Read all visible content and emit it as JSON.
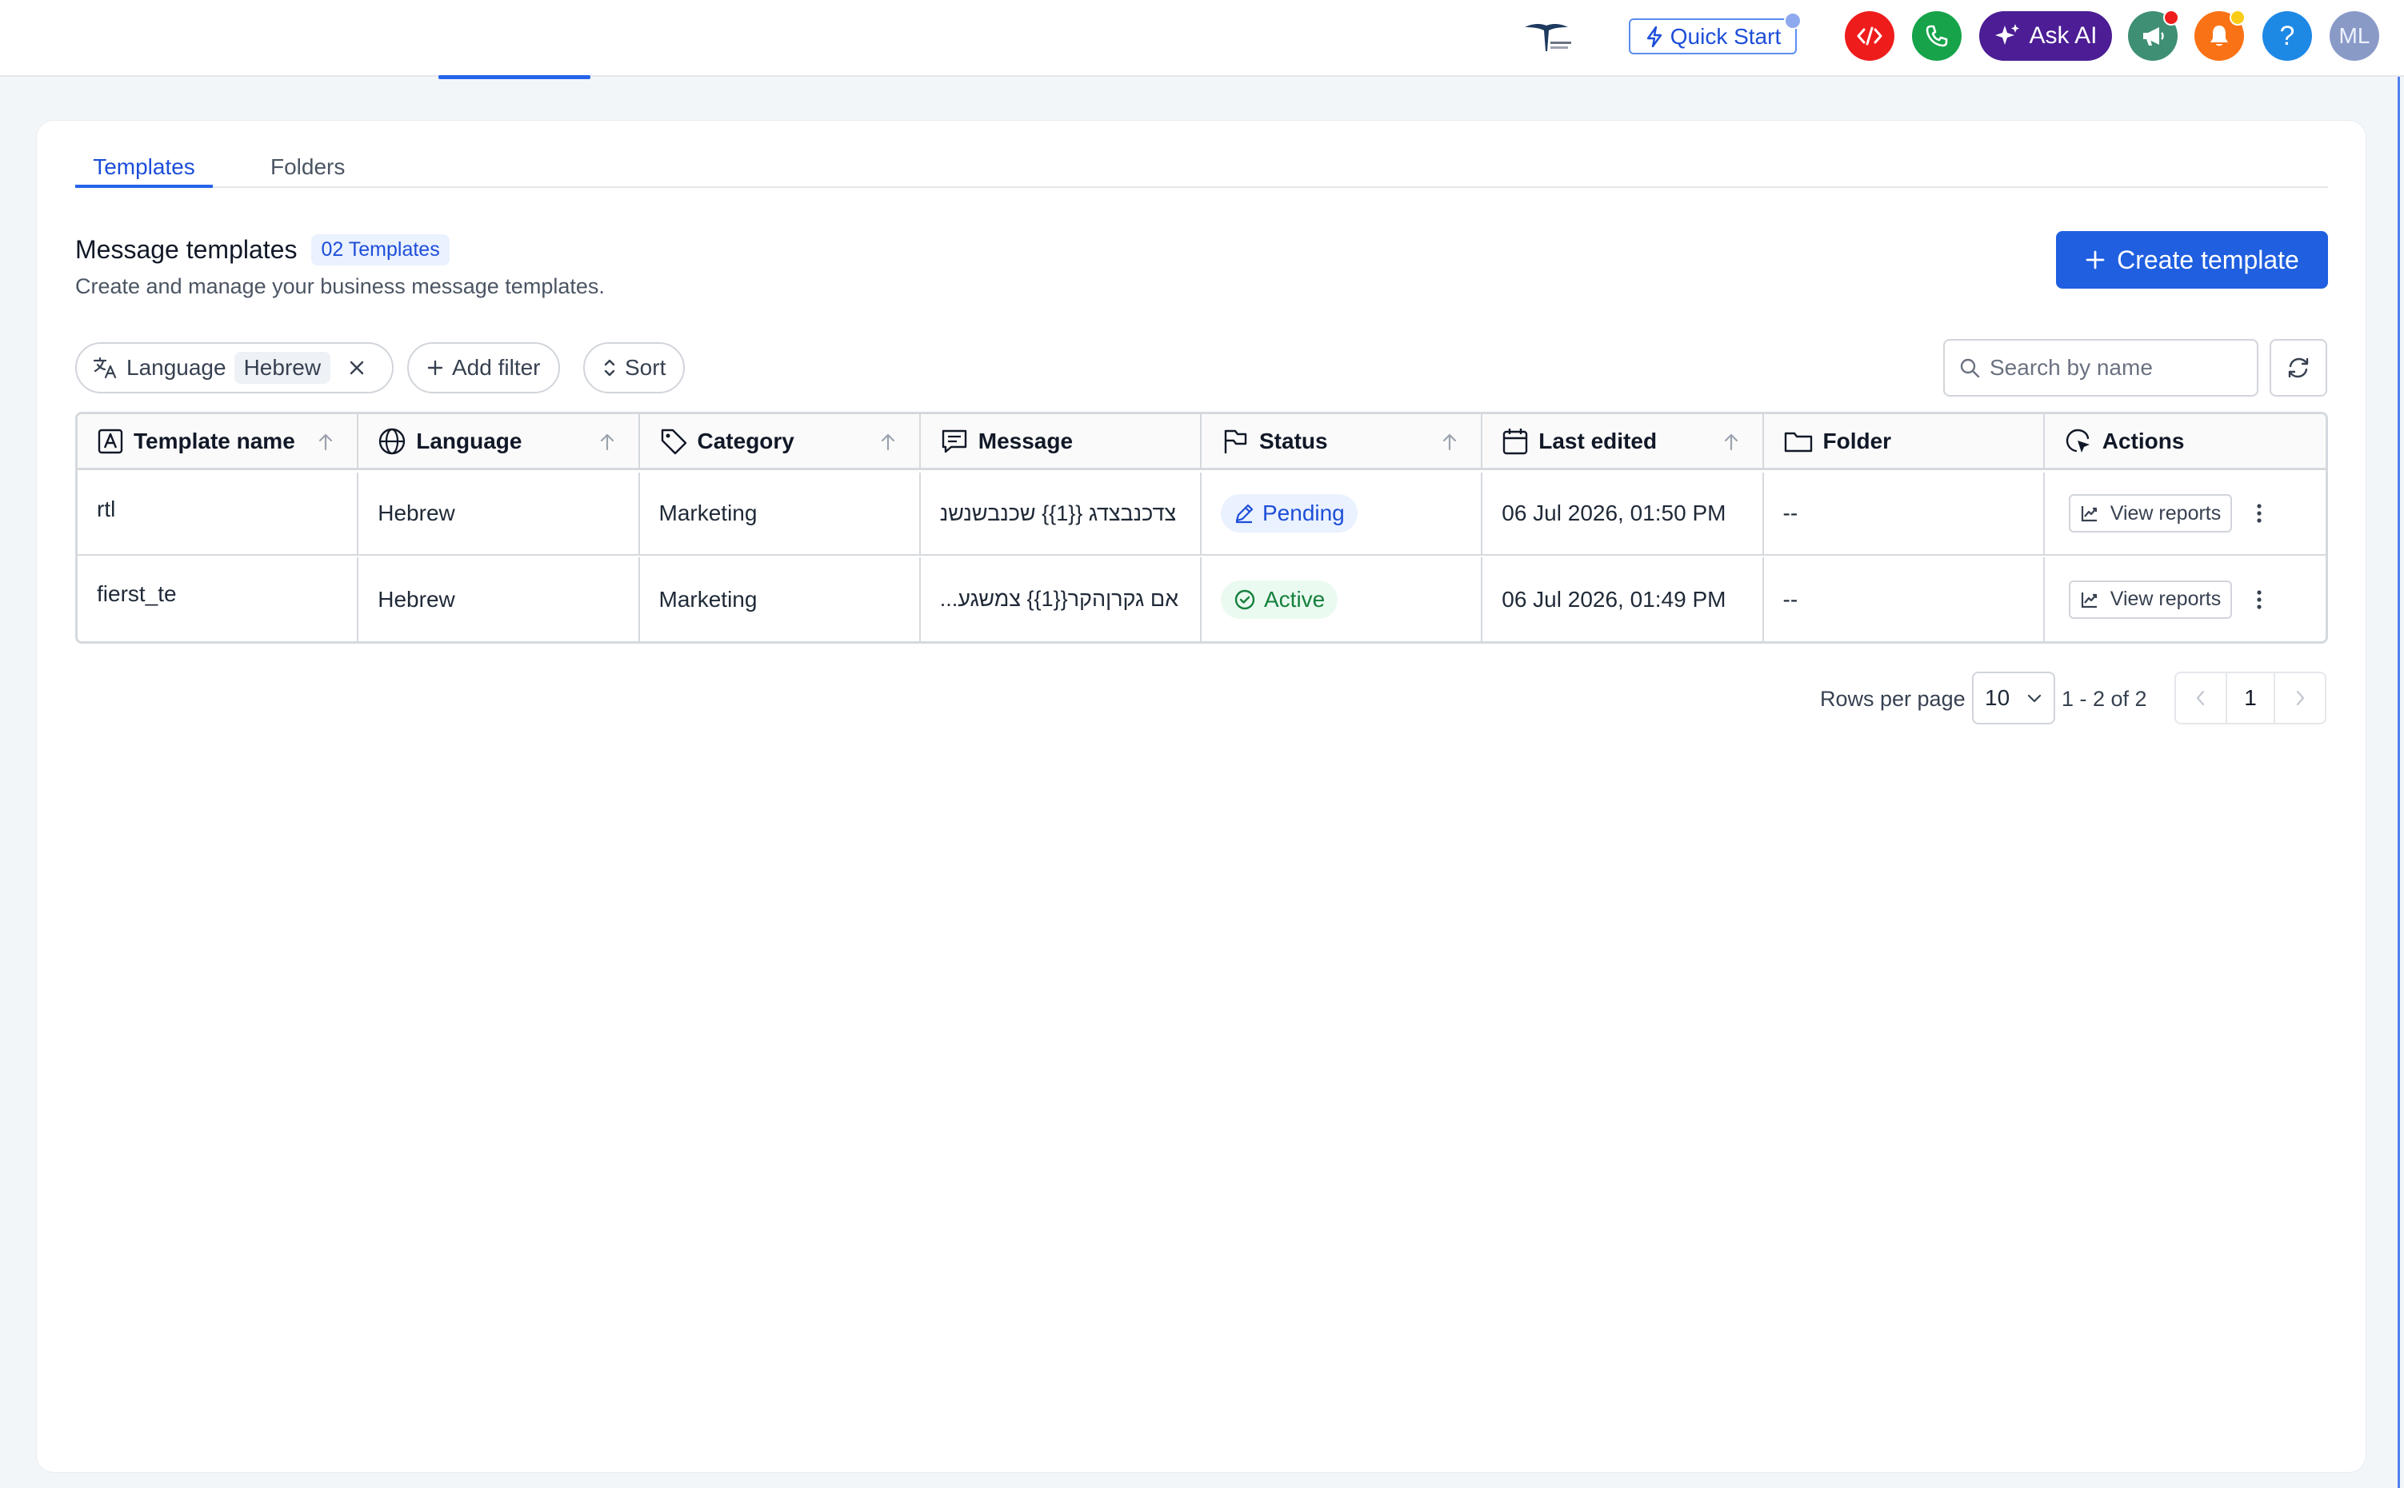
{
  "topbar": {
    "quick_start_label": "Quick Start",
    "ask_ai_label": "Ask AI",
    "help_label": "?",
    "avatar_initials": "ML",
    "colors": {
      "code": "#ef1c1c",
      "phone": "#16a34a",
      "ask_ai": "#4c1d95",
      "megaphone": "#3f8f74",
      "bell": "#f97316",
      "help": "#1e88e5"
    }
  },
  "tabs": [
    {
      "label": "Templates",
      "active": true
    },
    {
      "label": "Folders",
      "active": false
    }
  ],
  "header": {
    "title": "Message templates",
    "count_badge": "02 Templates",
    "subtitle": "Create and manage your business message templates.",
    "create_button": "Create template"
  },
  "filters": {
    "language_label": "Language",
    "language_value": "Hebrew",
    "add_filter_label": "Add filter",
    "sort_label": "Sort",
    "search_placeholder": "Search by name"
  },
  "table": {
    "columns": [
      "Template name",
      "Language",
      "Category",
      "Message",
      "Status",
      "Last edited",
      "Folder",
      "Actions"
    ],
    "rows": [
      {
        "name": "rtl",
        "language": "Hebrew",
        "category": "Marketing",
        "message": "צדכנבצדג {{1}} שכנבשנשנ",
        "status": "Pending",
        "last_edited": "06 Jul 2026, 01:50 PM",
        "folder": "--",
        "action": "View reports"
      },
      {
        "name": "fierst_te",
        "language": "Hebrew",
        "category": "Marketing",
        "message": "...אם גקרןהקר{{1}} צמשגע",
        "status": "Active",
        "last_edited": "06 Jul 2026, 01:49 PM",
        "folder": "--",
        "action": "View reports"
      }
    ]
  },
  "pagination": {
    "rows_per_page_label": "Rows per page",
    "rows_per_page_value": "10",
    "range": "1 - 2 of 2",
    "current_page": "1"
  }
}
